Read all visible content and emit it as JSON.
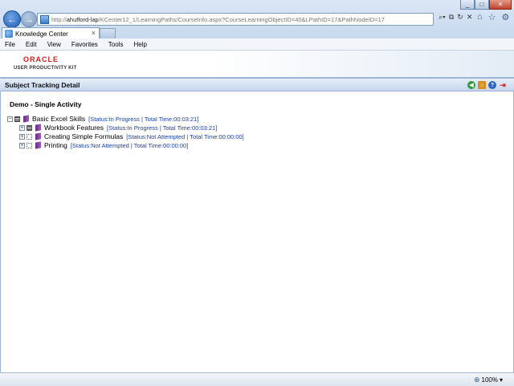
{
  "browser": {
    "url_prefix": "http://",
    "url_host": "ahufford-lap",
    "url_path": "/KCenter12_1/LearningPaths/CourseInfo.aspx?CourseLearningObjectID=40&LPathID=17&PathNodeID=17",
    "tab_title": "Knowledge Center",
    "zoom": "100%"
  },
  "menu": [
    "File",
    "Edit",
    "View",
    "Favorites",
    "Tools",
    "Help"
  ],
  "branding": {
    "oracle": "ORACLE",
    "product": "USER PRODUCTIVITY KIT"
  },
  "page": {
    "title": "Subject Tracking Detail",
    "activity_title": "Demo - Single Activity"
  },
  "tree": [
    {
      "label": "Basic Excel Skills",
      "status": "[Status:In Progress | Total Time:00:03:21]"
    },
    {
      "label": "Workbook Features",
      "status": "[Status:In Progress | Total Time:00:03:21]"
    },
    {
      "label": "Creating Simple Formulas",
      "status": "[Status:Not Attempted | Total Time:00:00:00]"
    },
    {
      "label": "Printing",
      "status": "[Status:Not Attempted | Total Time:00:00:00]"
    }
  ]
}
